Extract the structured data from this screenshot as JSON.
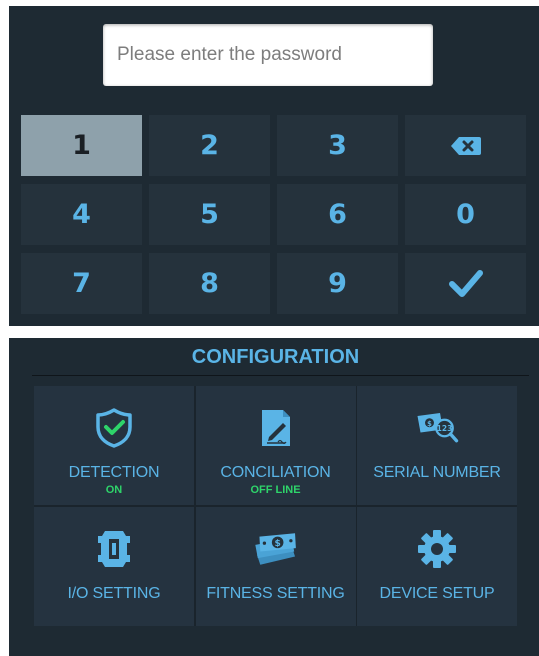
{
  "password": {
    "placeholder": "Please enter the password",
    "value": ""
  },
  "keypad": {
    "keys": [
      {
        "label": "1",
        "active": true
      },
      {
        "label": "2"
      },
      {
        "label": "3"
      },
      {
        "icon": "backspace-icon"
      },
      {
        "label": "4"
      },
      {
        "label": "5"
      },
      {
        "label": "6"
      },
      {
        "label": "0"
      },
      {
        "label": "7"
      },
      {
        "label": "8"
      },
      {
        "label": "9"
      },
      {
        "icon": "checkmark-icon"
      }
    ]
  },
  "configuration": {
    "title": "CONFIGURATION",
    "tiles": [
      {
        "label": "DETECTION",
        "status": "ON",
        "icon": "shield-check-icon"
      },
      {
        "label": "CONCILIATION",
        "status": "OFF LINE",
        "icon": "document-edit-icon"
      },
      {
        "label": "SERIAL NUMBER",
        "icon": "banknote-search-icon"
      },
      {
        "label": "I/O SETTING",
        "icon": "io-connector-icon"
      },
      {
        "label": "FITNESS SETTING",
        "icon": "banknote-stack-icon"
      },
      {
        "label": "DEVICE SETUP",
        "icon": "gear-icon"
      }
    ]
  },
  "colors": {
    "panel_bg": "#1e2a33",
    "key_bg": "#25323c",
    "key_active_bg": "#8ea1ab",
    "accent_blue": "#5ab4e6",
    "status_green": "#2ed46a"
  }
}
